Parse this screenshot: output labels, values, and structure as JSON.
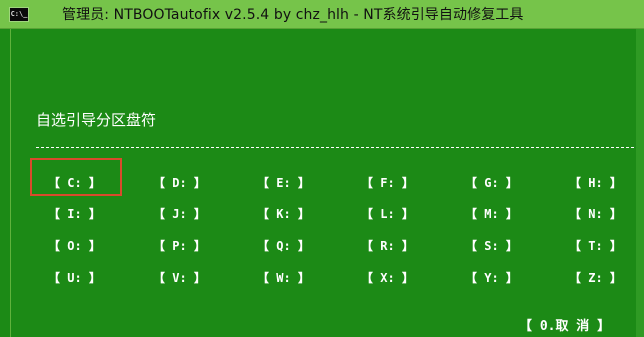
{
  "window": {
    "title": "管理员:  NTBOOTautofix v2.5.4 by chz_hlh - NT系统引导自动修复工具",
    "icon_text": "C:\\_"
  },
  "console": {
    "heading": "自选引导分区盘符",
    "divider": "--------------------------------------------------------------------------------------------------------------",
    "selected_drive": "C:",
    "drives": [
      [
        "【 C: 】",
        "【 D: 】",
        "【 E: 】",
        "【 F: 】",
        "【 G: 】",
        "【 H: 】"
      ],
      [
        "【 I: 】",
        "【 J: 】",
        "【 K: 】",
        "【 L: 】",
        "【 M: 】",
        "【 N: 】"
      ],
      [
        "【 O: 】",
        "【 P: 】",
        "【 Q: 】",
        "【 R: 】",
        "【 S: 】",
        "【 T: 】"
      ],
      [
        "【 U: 】",
        "【 V: 】",
        "【 W: 】",
        "【 X: 】",
        "【 Y: 】",
        "【 Z: 】"
      ]
    ],
    "cancel_label": "【 0.取  消 】"
  },
  "colors": {
    "background": "#1c8a16",
    "titlebar": "#76c44a",
    "text": "#ffffff",
    "highlight": "#d84a2c"
  }
}
